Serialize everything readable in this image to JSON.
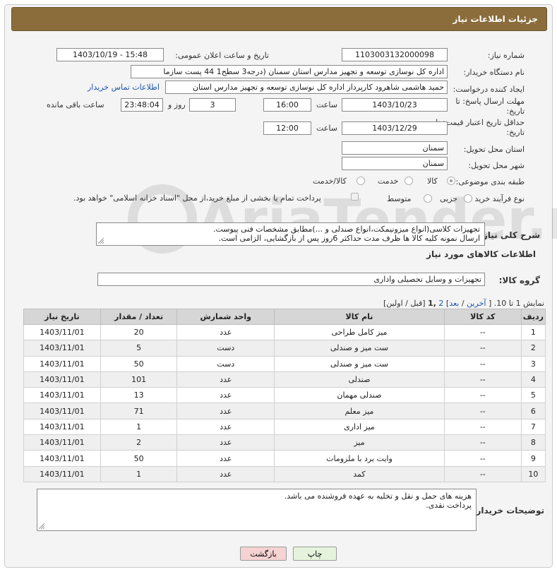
{
  "header": {
    "title": "جزئیات اطلاعات نیاز"
  },
  "fields": {
    "need_number_label": "شماره نیاز:",
    "need_number": "1103003132000098",
    "announce_label": "تاریخ و ساعت اعلان عمومی:",
    "announce_value": "1403/10/19 - 15:48",
    "buyer_org_label": "نام دستگاه خریدار:",
    "buyer_org": "اداره کل نوسازی   توسعه و تجهیز مدارس استان سمنان (درجه3  سطح1  44 پست سازما",
    "creator_label": "ایجاد کننده درخواست:",
    "creator": "حمید هاشمی شاهرود کارپرداز اداره کل نوسازی   توسعه و تجهیز مدارس استان",
    "contact_link": "اطلاعات تماس خریدار",
    "deadline_label": "مهلت ارسال پاسخ: تا",
    "deadline_label2": "تاریخ:",
    "deadline_date": "1403/10/23",
    "time_label": "ساعت",
    "deadline_time": "16:00",
    "days_value": "3",
    "days_label": "روز و",
    "remaining_value": "23:48:04",
    "remaining_label": "ساعت باقی مانده",
    "min_valid_label": "حداقل تاریخ اعتبار قیمت: تا",
    "min_valid_label2": "تاریخ:",
    "min_valid_date": "1403/12/29",
    "min_valid_time": "12:00",
    "province_label": "استان محل تحویل:",
    "province": "سمنان",
    "city_label": "شهر محل تحویل:",
    "city": "سمنان",
    "category_label": "طبقه بندی موضوعی:",
    "cat_goods": "کالا",
    "cat_service": "خدمت",
    "cat_both": "کالا/خدمت",
    "process_label": "نوع فرآیند خرید :",
    "proc_partial": "جزیی",
    "proc_medium": "متوسط",
    "payment_note": "پرداخت تمام یا بخشی از مبلغ خرید،از محل \"اسناد خزانه اسلامی\" خواهد بود."
  },
  "description": {
    "label": "شرح کلی نیاز:",
    "line1": "تجهیزات کلاسی(انواع میزونیمکت،انواع صندلی و ...)مطابق مشخصات فنی پیوست.",
    "line2": "ارسال نمونه کلیه کالا ها ظرف مدت حداکثر 6روز پس از بازگشایی، الزامی است."
  },
  "goods_section": {
    "title": "اطلاعات کالاهای مورد نیاز",
    "group_label": "گروه کالا:",
    "group_value": "تجهیزات و وسایل تحصیلی واداری"
  },
  "pagination": {
    "showing": "نمایش 1 تا 10. [",
    "last": "آخرین",
    "sep1": "/",
    "next": "بعد",
    "sep2": "]",
    "page2": "2",
    "page1": ",1",
    "prev_first": "[قبل / اولین]"
  },
  "table": {
    "headers": [
      "ردیف",
      "کد کالا",
      "نام کالا",
      "واحد شمارش",
      "تعداد / مقدار",
      "تاریخ نیاز"
    ],
    "rows": [
      [
        "1",
        "--",
        "میز کامل طراحی",
        "عدد",
        "20",
        "1403/11/01"
      ],
      [
        "2",
        "--",
        "ست میز و صندلی",
        "دست",
        "5",
        "1403/11/01"
      ],
      [
        "3",
        "--",
        "ست میز و صندلی",
        "دست",
        "50",
        "1403/11/01"
      ],
      [
        "4",
        "--",
        "صندلی",
        "عدد",
        "101",
        "1403/11/01"
      ],
      [
        "5",
        "--",
        "صندلی مهمان",
        "عدد",
        "13",
        "1403/11/01"
      ],
      [
        "6",
        "--",
        "میز معلم",
        "عدد",
        "71",
        "1403/11/01"
      ],
      [
        "7",
        "--",
        "میز اداری",
        "عدد",
        "1",
        "1403/11/01"
      ],
      [
        "8",
        "--",
        "میز",
        "عدد",
        "2",
        "1403/11/01"
      ],
      [
        "9",
        "--",
        "وایت برد با ملزومات",
        "عدد",
        "50",
        "1403/11/01"
      ],
      [
        "10",
        "--",
        "کمد",
        "عدد",
        "1",
        "1403/11/01"
      ]
    ]
  },
  "buyer_notes": {
    "label": "توضیحات خریدار:",
    "line1": "هزینه های حمل و نقل و تخلیه به عهده فروشنده می باشد.",
    "line2": "پرداخت نقدی."
  },
  "buttons": {
    "print": "چاپ",
    "back": "بازگشت"
  },
  "watermark": {
    "text": "AriaTender.neT"
  },
  "colors": {
    "header": "#8a6d3b",
    "print_btn": "#e6f3dc",
    "back_btn": "#f5d3d3"
  }
}
